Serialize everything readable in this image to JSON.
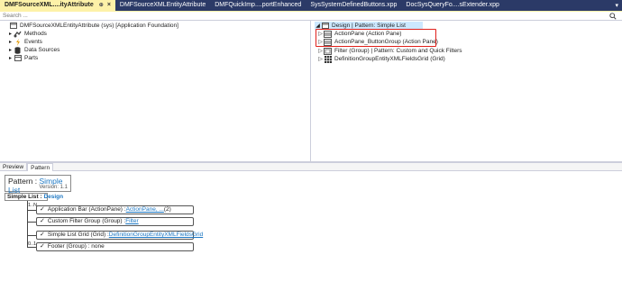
{
  "tabs": [
    {
      "label": "DMFSourceXML....ityAttribute",
      "active": true
    },
    {
      "label": "DMFSourceXMLEntityAttribute",
      "active": false
    },
    {
      "label": "DMFQuickImp....portEnhanced",
      "active": false
    },
    {
      "label": "SysSystemDefinedButtons.xpp",
      "active": false
    },
    {
      "label": "DocSysQueryFo....sExtender.xpp",
      "active": false
    }
  ],
  "search": {
    "placeholder": "Search ..."
  },
  "left_tree": {
    "root": "DMFSourceXMLEntityAttribute (sys) [Application Foundation]",
    "items": [
      {
        "label": "Methods",
        "icon": "methods-icon"
      },
      {
        "label": "Events",
        "icon": "events-icon"
      },
      {
        "label": "Data Sources",
        "icon": "datasource-icon"
      },
      {
        "label": "Parts",
        "icon": "parts-icon"
      }
    ]
  },
  "right_tree": {
    "root": "Design | Pattern: Simple List",
    "items": [
      {
        "label": "ActionPane (Action Pane)",
        "icon": "actionpane-icon"
      },
      {
        "label": "ActionPane_ButtonGroup (Action Pane)",
        "icon": "actionpane-icon"
      },
      {
        "label": "Filter (Group) | Pattern: Custom and Quick Filters",
        "icon": "group-icon"
      },
      {
        "label": "DefinitionGroupEntityXMLFieldsGrid (Grid)",
        "icon": "grid-icon"
      }
    ]
  },
  "bottom_tabs": [
    {
      "label": "Preview",
      "active": false
    },
    {
      "label": "Pattern",
      "active": true
    }
  ],
  "pattern": {
    "title_prefix": "Pattern : ",
    "title_link": "Simple List",
    "version": "Version: 1.1",
    "simple_list_label": "Simple List : ",
    "simple_list_link": "Design",
    "multiplicity_top": "1..N",
    "multiplicity_bottom": "0..1",
    "cards": [
      {
        "check": "✓",
        "text": "Application Bar (ActionPane) : ",
        "link": "ActionPane, ...",
        "suffix": " (2)"
      },
      {
        "check": "✓",
        "text": "Custom Filter Group (Group) : ",
        "link": "Filter",
        "suffix": ""
      },
      {
        "check": "✓",
        "text": "Simple List Grid (Grid) : ",
        "link": "DefinitionGroupEntityXMLFieldsGrid",
        "suffix": ""
      },
      {
        "check": "✓",
        "text": "Footer (Group) : none",
        "link": "",
        "suffix": ""
      }
    ]
  },
  "colors": {
    "tabbar_bg": "#2b3a67",
    "active_tab_bg": "#fdf1a8",
    "selected_row": "#cce8ff",
    "link": "#1c77c3",
    "highlight": "#e0201b"
  }
}
